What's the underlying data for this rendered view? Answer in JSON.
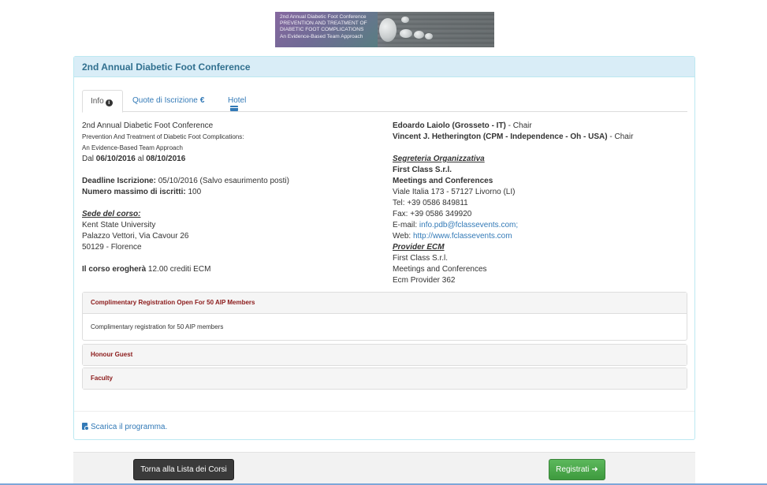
{
  "banner": {
    "lines": [
      "2nd Annual Diabetic Foot Conference",
      "PREVENTION AND TREATMENT OF",
      "DIABETIC FOOT COMPLICATIONS",
      "An Evidence-Based Team Approach"
    ]
  },
  "panel": {
    "title": "2nd Annual Diabetic Foot Conference"
  },
  "tabs": [
    {
      "label": "Info",
      "active": true,
      "icon": "info-circle-icon"
    },
    {
      "label": "Quote di Iscrizione",
      "active": false,
      "icon": "euro-icon"
    },
    {
      "label": "Hotel",
      "active": false,
      "icon": "credit-card-icon"
    }
  ],
  "info": {
    "course_title": "2nd Annual Diabetic Foot Conference",
    "subtitle_1": "Prevention And Treatment of Diabetic Foot Complications:",
    "subtitle_2": "An Evidence-Based Team Approach",
    "date_prefix": "Dal ",
    "date_from": "06/10/2016",
    "date_mid": " al ",
    "date_to": "08/10/2016",
    "deadline_label": "Deadline Iscrizione:",
    "deadline_value": " 05/10/2016 (Salvo esaurimento posti)",
    "max_label": "Numero massimo di iscritti:",
    "max_value": " 100",
    "venue_heading": "Sede del corso:",
    "venue_lines": [
      "Kent State University",
      "Palazzo Vettori, Via Cavour 26",
      "50129 - Florence"
    ],
    "credits_label": "Il corso erogherà",
    "credits_value": " 12.00 crediti ECM"
  },
  "right": {
    "chair_1_name": "Edoardo Laiolo (Grosseto - IT)",
    "chair_1_role": " - Chair",
    "chair_2_name": "Vincent J. Hetherington (CPM - Independence - Oh - USA)",
    "chair_2_role": " - Chair",
    "secretariat_heading": "Segreteria Organizzativa",
    "secretariat_name_1": "First Class S.r.l.",
    "secretariat_name_2": "Meetings and Conferences",
    "address": "Viale Italia 173 - 57127 Livorno (LI)",
    "tel": "Tel: +39 0586 849811",
    "fax": "Fax: +39 0586 349920",
    "email_label": "E-mail: ",
    "email": "info.pdb@fclassevents.com;",
    "web_label": "Web: ",
    "web": "http://www.fclassevents.com",
    "provider_heading": "Provider ECM",
    "provider_lines": [
      "First Class S.r.l.",
      "Meetings and Conferences",
      "Ecm Provider 362"
    ]
  },
  "accordion": [
    {
      "title": "Complimentary Registration Open For 50 AIP Members",
      "body": "Complimentary registration for 50 AIP members",
      "expanded": true
    },
    {
      "title": "Honour Guest",
      "expanded": false
    },
    {
      "title": "Faculty",
      "expanded": false
    }
  ],
  "download": {
    "label": "Scarica il programma."
  },
  "buttons": {
    "back": "Torna alla Lista dei Corsi",
    "register": "Registrati"
  }
}
